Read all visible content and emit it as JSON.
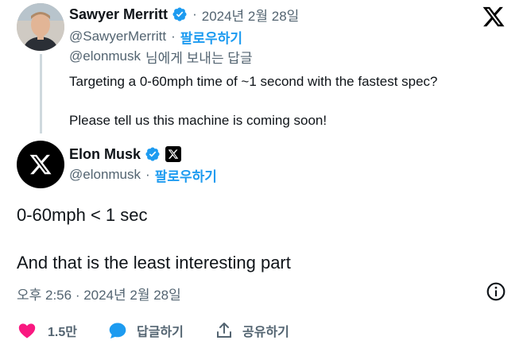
{
  "reply_tweet": {
    "author_name": "Sawyer Merritt",
    "date": "2024년 2월 28일",
    "handle": "@SawyerMerritt",
    "follow_label": "팔로우하기",
    "replying_to_handle": "@elonmusk",
    "replying_to_suffix": "님에게 보내는 답글",
    "body_line1": "Targeting a 0-60mph time of ~1 second with the fastest spec?",
    "body_line2": "Please tell us this machine is coming soon!"
  },
  "main_tweet": {
    "author_name": "Elon Musk",
    "handle": "@elonmusk",
    "follow_label": "팔로우하기",
    "text_line1": "0-60mph < 1 sec",
    "text_line2": "And that is the least interesting part",
    "timestamp": "오후 2:56 · 2024년 2월 28일"
  },
  "actions": {
    "like_count": "1.5만",
    "reply_label": "답글하기",
    "share_label": "공유하기"
  },
  "separator": "·",
  "icons": [
    "x-logo-icon",
    "verified-badge-icon",
    "info-icon",
    "heart-icon",
    "reply-bubble-icon",
    "share-icon"
  ],
  "colors": {
    "verified": "#1d9bf0",
    "follow": "#1d9bf0",
    "like": "#f91880",
    "muted": "#536471"
  }
}
